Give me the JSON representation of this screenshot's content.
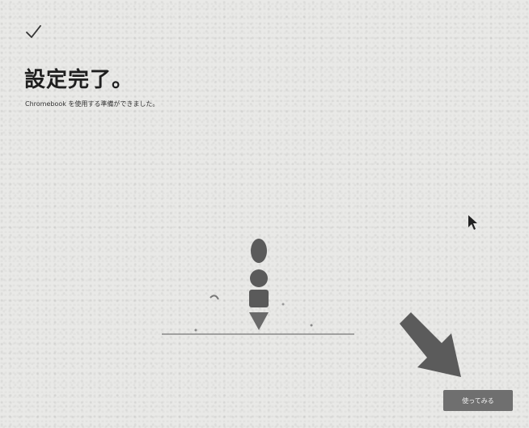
{
  "header": {
    "title": "設定完了。",
    "subtitle": "Chromebook を使用する準備ができました。"
  },
  "footer": {
    "next_button_label": "使ってみる"
  },
  "icons": {
    "status": "checkmark-icon",
    "pointer": "mouse-cursor-icon",
    "annotation": "annotation-arrow-icon"
  },
  "colors": {
    "background": "#e9e9e7",
    "button": "#6f6f6f",
    "illustration": "#5a5a5a"
  }
}
